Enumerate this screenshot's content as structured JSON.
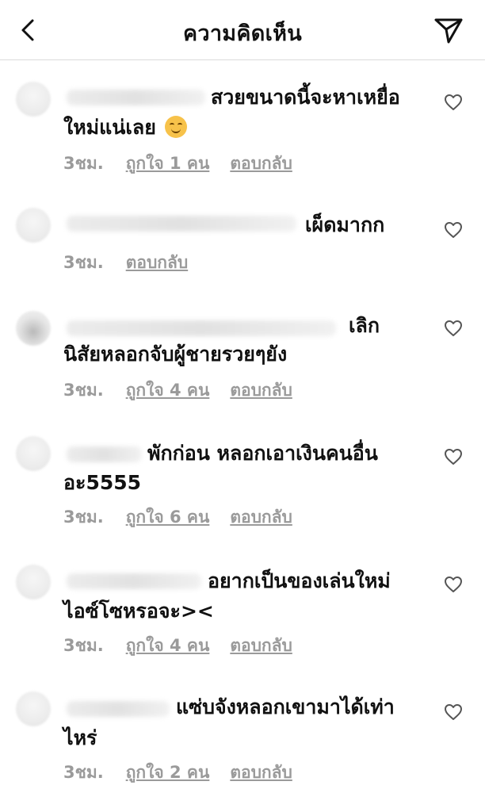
{
  "header": {
    "title": "ความคิดเห็น"
  },
  "comments": [
    {
      "line1": "สวยขนาดนี้จะหาเหยื่อ",
      "line2": "ใหม่แน่เลย",
      "time": "3ชม.",
      "likes": "ถูกใจ 1 คน",
      "reply": "ตอบกลับ"
    },
    {
      "line1": "เผ็ดมากก",
      "line2": "",
      "time": "3ชม.",
      "likes": "",
      "reply": "ตอบกลับ"
    },
    {
      "line1": "เลิก",
      "line2": "นิสัยหลอกจับผู้ชายรวยๆยัง",
      "time": "3ชม.",
      "likes": "ถูกใจ 4 คน",
      "reply": "ตอบกลับ"
    },
    {
      "line1": "พักก่อน หลอกเอาเงินคนอื่น",
      "line2": "อะ5555",
      "time": "3ชม.",
      "likes": "ถูกใจ 6 คน",
      "reply": "ตอบกลับ"
    },
    {
      "line1": "อยากเป็นของเล่นใหม่",
      "line2": "ไอซ์โซหรอจะ><",
      "time": "3ชม.",
      "likes": "ถูกใจ 4 คน",
      "reply": "ตอบกลับ"
    },
    {
      "line1": "แซ่บจังหลอกเขามาได้เท่า",
      "line2": "ไหร่",
      "time": "3ชม.",
      "likes": "ถูกใจ 2 คน",
      "reply": "ตอบกลับ"
    }
  ],
  "icons": {
    "back": "chevron-left-icon",
    "send": "send-icon",
    "like": "heart-icon",
    "emoji": "woozy-face-emoji"
  }
}
